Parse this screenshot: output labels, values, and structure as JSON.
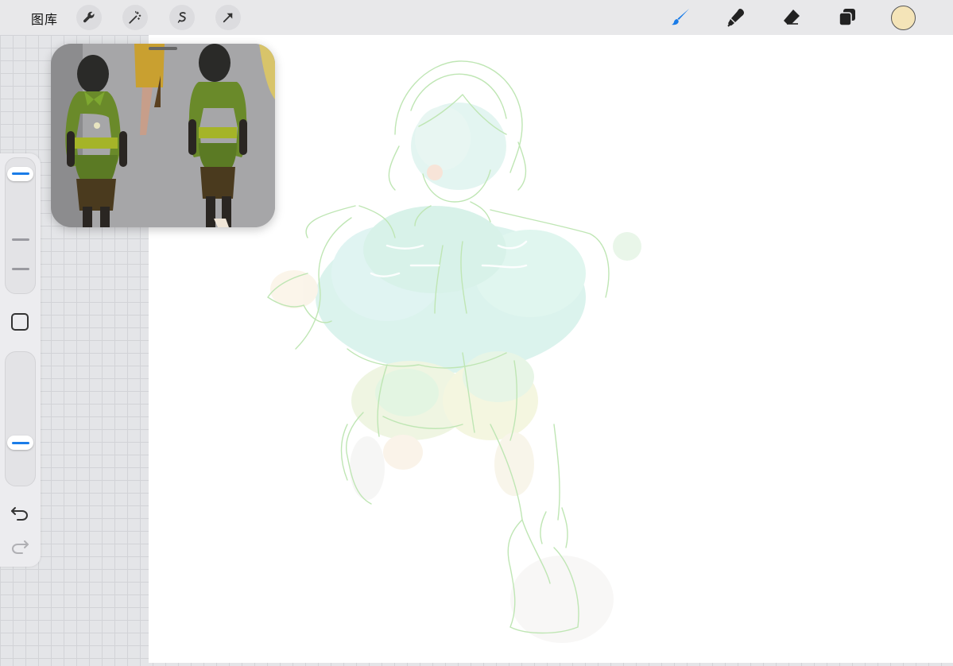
{
  "topbar": {
    "gallery_label": "图库",
    "left_tools": [
      {
        "name": "actions",
        "icon": "wrench-icon"
      },
      {
        "name": "adjustments",
        "icon": "magic-wand-icon"
      },
      {
        "name": "selection",
        "icon": "selection-s-icon"
      },
      {
        "name": "transform",
        "icon": "arrow-icon"
      }
    ],
    "right_tools": [
      {
        "name": "brush",
        "icon": "brush-icon",
        "active": true
      },
      {
        "name": "smudge",
        "icon": "smudge-icon",
        "active": false
      },
      {
        "name": "eraser",
        "icon": "eraser-icon",
        "active": false
      },
      {
        "name": "layers",
        "icon": "layers-icon",
        "active": false
      }
    ],
    "active_color": "#f4e4b8",
    "accent_color": "#1a7ce8"
  },
  "sidebar": {
    "brush_size_level": 0.07,
    "opacity_level": 0.7,
    "modify_icon": "square-icon",
    "undo_icon": "undo-icon",
    "redo_icon": "redo-icon"
  },
  "reference_window": {
    "image": "reference-figure-photo",
    "background_color": "#a4a4a6"
  },
  "canvas": {
    "background_color": "#ffffff",
    "artwork": "character-sketch"
  }
}
